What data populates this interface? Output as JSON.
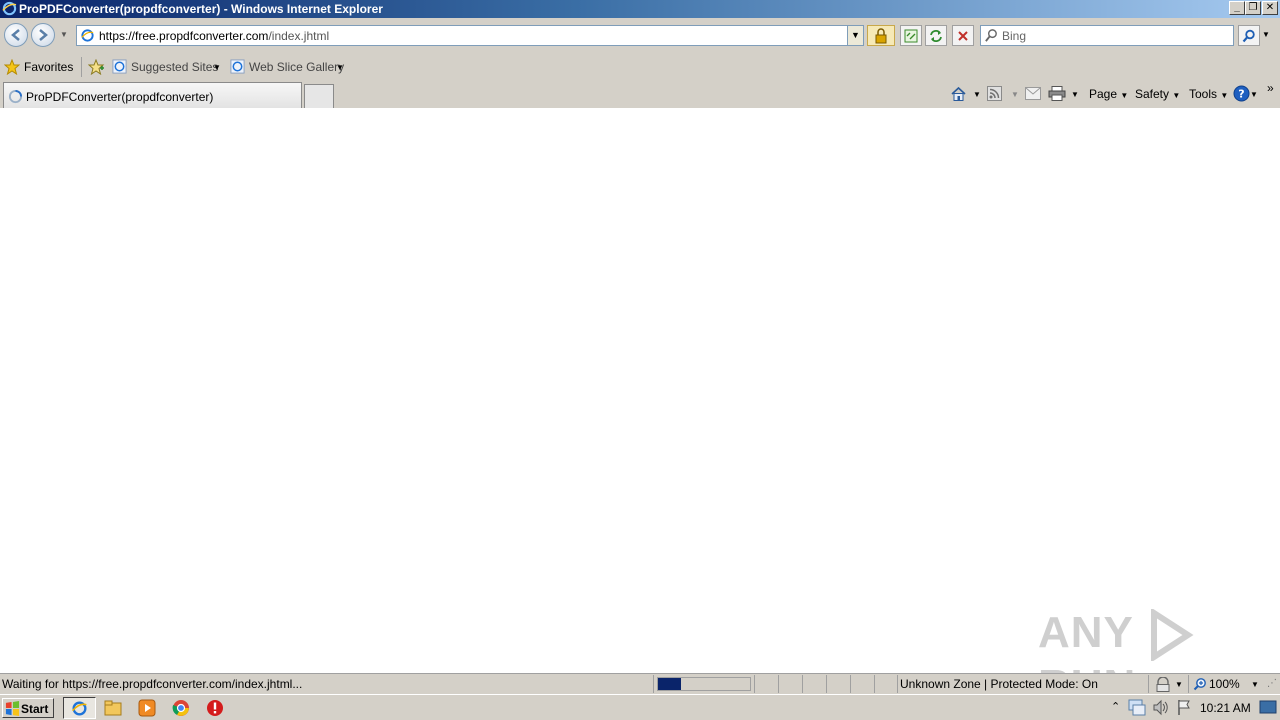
{
  "window": {
    "title": "ProPDFConverter(propdfconverter) - Windows Internet Explorer",
    "caption_buttons": [
      "minimize",
      "restore",
      "close"
    ]
  },
  "address_bar": {
    "url_protocol": "https://",
    "url_domain": "free.propdfconverter.com",
    "url_path": "/index.jhtml"
  },
  "search": {
    "placeholder": "Bing"
  },
  "favorites_bar": {
    "favorites_label": "Favorites",
    "items": [
      {
        "label": "Suggested Sites"
      },
      {
        "label": "Web Slice Gallery"
      }
    ]
  },
  "tabs": [
    {
      "label": "ProPDFConverter(propdfconverter)"
    }
  ],
  "command_bar": {
    "page_label": "Page",
    "safety_label": "Safety",
    "tools_label": "Tools"
  },
  "status_bar": {
    "status_text": "Waiting for https://free.propdfconverter.com/index.jhtml...",
    "progress": 0.25,
    "zone_text": "Unknown Zone | Protected Mode: On",
    "zoom_text": "100%"
  },
  "taskbar": {
    "start_label": "Start",
    "clock": "10:21 AM"
  },
  "watermark": {
    "left": "ANY",
    "right": "RUN"
  },
  "colors": {
    "titlebar_start": "#0a246a",
    "titlebar_end": "#a6caf0",
    "chrome": "#d4d0c8",
    "progress_fill": "#0a246a"
  }
}
